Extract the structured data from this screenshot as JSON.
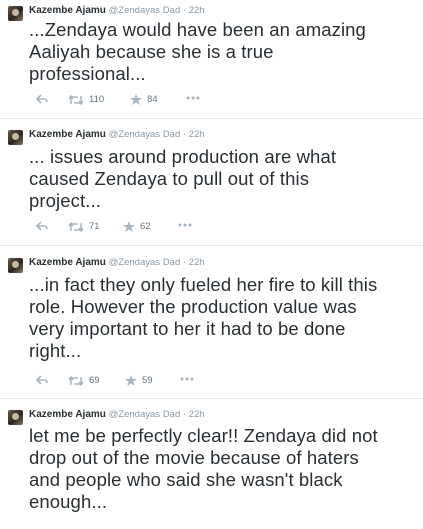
{
  "tweets": [
    {
      "author": "Kazembe Ajamu",
      "handle": "@Zendayas",
      "meta": "Dad · 22h",
      "lines": [
        "...Zendaya would have been an amazing",
        "Aaliyah because she is a true",
        "professional..."
      ],
      "retweets": "110",
      "favorites": "84"
    },
    {
      "author": "Kazembe Ajamu",
      "handle": "@Zendayas",
      "meta": "Dad · 22h",
      "lines": [
        "... issues around production are what",
        "caused Zendaya to pull out of this",
        "project..."
      ],
      "retweets": "71",
      "favorites": "62"
    },
    {
      "author": "Kazembe Ajamu",
      "handle": "@Zendayas",
      "meta": "Dad · 22h",
      "lines": [
        "...in fact they only fueled her fire to kill this",
        "role. However the production value was",
        "very important to her it had to be done",
        "right..."
      ],
      "retweets": "69",
      "favorites": "59"
    },
    {
      "author": "Kazembe Ajamu",
      "handle": "@Zendayas",
      "meta": "Dad · 22h",
      "lines": [
        "let me be perfectly clear!! Zendaya did not",
        "drop out of the movie because of haters",
        "and people who said she wasn't black",
        "enough..."
      ]
    }
  ]
}
